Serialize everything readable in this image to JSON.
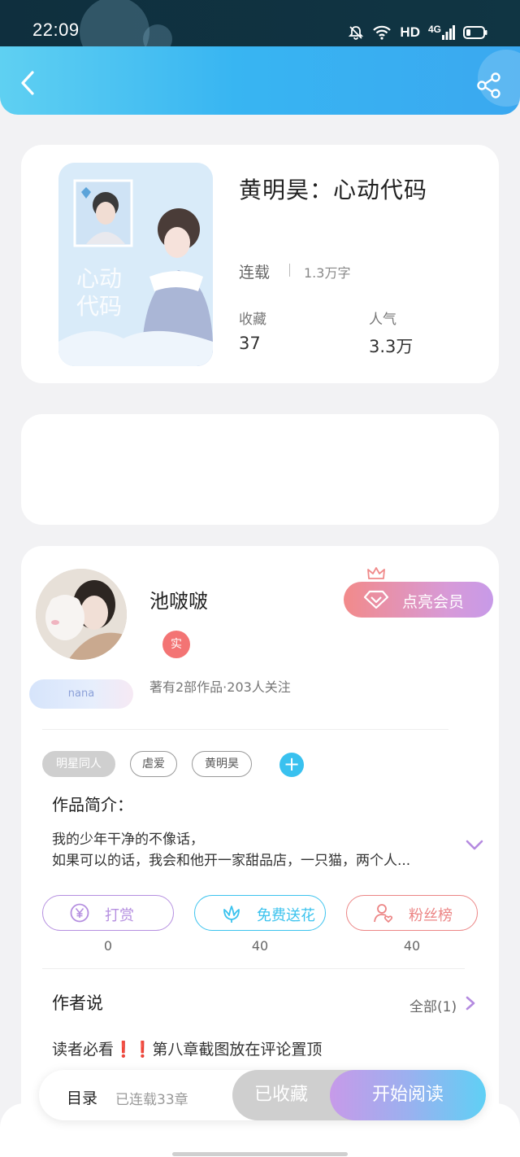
{
  "status_bar": {
    "time": "22:09",
    "network": "HD",
    "signal_type": "4G"
  },
  "book": {
    "title": "黄明昊：心动代码",
    "status": "连载",
    "word_count": "1.3万字",
    "favorites_label": "收藏",
    "favorites_value": "37",
    "popularity_label": "人气",
    "popularity_value": "3.3万",
    "cover_text": "心动代码"
  },
  "author": {
    "name": "池啵啵",
    "verified_label": "实",
    "badge_label": "nana",
    "meta": "著有2部作品·203人关注",
    "vip_button": "点亮会员"
  },
  "tags": [
    "明星同人",
    "虐爱",
    "黄明昊"
  ],
  "intro": {
    "title": "作品简介：",
    "line1": "我的少年干净的不像话，",
    "line2": "如果可以的话，我会和他开一家甜品店，一只猫，两个人..."
  },
  "actions": [
    {
      "label": "打赏",
      "count": "0",
      "color": "#b58fe0",
      "icon": "yen-icon"
    },
    {
      "label": "免费送花",
      "count": "40",
      "color": "#3cc3ee",
      "icon": "flower-icon"
    },
    {
      "label": "粉丝榜",
      "count": "40",
      "color": "#ec8585",
      "icon": "fan-icon"
    }
  ],
  "author_says": {
    "title": "作者说",
    "see_all": "全部(1)",
    "note_prefix": "读者必看",
    "note_marks": "❗❗",
    "note_suffix": "第八章截图放在评论置顶"
  },
  "bottom_bar": {
    "toc_label": "目录",
    "chapter_count": "已连载33章",
    "favorited_button": "已收藏",
    "read_button": "开始阅读"
  },
  "colors": {
    "accent_blue": "#38b5f2",
    "accent_purple": "#c79ae9"
  }
}
